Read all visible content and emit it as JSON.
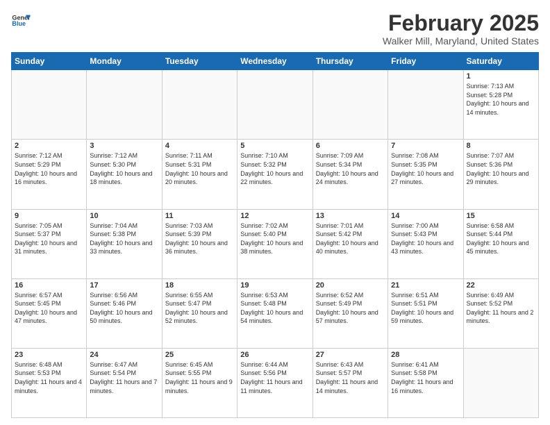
{
  "header": {
    "logo_line1": "General",
    "logo_line2": "Blue",
    "title": "February 2025",
    "subtitle": "Walker Mill, Maryland, United States"
  },
  "days_of_week": [
    "Sunday",
    "Monday",
    "Tuesday",
    "Wednesday",
    "Thursday",
    "Friday",
    "Saturday"
  ],
  "weeks": [
    [
      {
        "day": "",
        "info": ""
      },
      {
        "day": "",
        "info": ""
      },
      {
        "day": "",
        "info": ""
      },
      {
        "day": "",
        "info": ""
      },
      {
        "day": "",
        "info": ""
      },
      {
        "day": "",
        "info": ""
      },
      {
        "day": "1",
        "info": "Sunrise: 7:13 AM\nSunset: 5:28 PM\nDaylight: 10 hours and 14 minutes."
      }
    ],
    [
      {
        "day": "2",
        "info": "Sunrise: 7:12 AM\nSunset: 5:29 PM\nDaylight: 10 hours and 16 minutes."
      },
      {
        "day": "3",
        "info": "Sunrise: 7:12 AM\nSunset: 5:30 PM\nDaylight: 10 hours and 18 minutes."
      },
      {
        "day": "4",
        "info": "Sunrise: 7:11 AM\nSunset: 5:31 PM\nDaylight: 10 hours and 20 minutes."
      },
      {
        "day": "5",
        "info": "Sunrise: 7:10 AM\nSunset: 5:32 PM\nDaylight: 10 hours and 22 minutes."
      },
      {
        "day": "6",
        "info": "Sunrise: 7:09 AM\nSunset: 5:34 PM\nDaylight: 10 hours and 24 minutes."
      },
      {
        "day": "7",
        "info": "Sunrise: 7:08 AM\nSunset: 5:35 PM\nDaylight: 10 hours and 27 minutes."
      },
      {
        "day": "8",
        "info": "Sunrise: 7:07 AM\nSunset: 5:36 PM\nDaylight: 10 hours and 29 minutes."
      }
    ],
    [
      {
        "day": "9",
        "info": "Sunrise: 7:05 AM\nSunset: 5:37 PM\nDaylight: 10 hours and 31 minutes."
      },
      {
        "day": "10",
        "info": "Sunrise: 7:04 AM\nSunset: 5:38 PM\nDaylight: 10 hours and 33 minutes."
      },
      {
        "day": "11",
        "info": "Sunrise: 7:03 AM\nSunset: 5:39 PM\nDaylight: 10 hours and 36 minutes."
      },
      {
        "day": "12",
        "info": "Sunrise: 7:02 AM\nSunset: 5:40 PM\nDaylight: 10 hours and 38 minutes."
      },
      {
        "day": "13",
        "info": "Sunrise: 7:01 AM\nSunset: 5:42 PM\nDaylight: 10 hours and 40 minutes."
      },
      {
        "day": "14",
        "info": "Sunrise: 7:00 AM\nSunset: 5:43 PM\nDaylight: 10 hours and 43 minutes."
      },
      {
        "day": "15",
        "info": "Sunrise: 6:58 AM\nSunset: 5:44 PM\nDaylight: 10 hours and 45 minutes."
      }
    ],
    [
      {
        "day": "16",
        "info": "Sunrise: 6:57 AM\nSunset: 5:45 PM\nDaylight: 10 hours and 47 minutes."
      },
      {
        "day": "17",
        "info": "Sunrise: 6:56 AM\nSunset: 5:46 PM\nDaylight: 10 hours and 50 minutes."
      },
      {
        "day": "18",
        "info": "Sunrise: 6:55 AM\nSunset: 5:47 PM\nDaylight: 10 hours and 52 minutes."
      },
      {
        "day": "19",
        "info": "Sunrise: 6:53 AM\nSunset: 5:48 PM\nDaylight: 10 hours and 54 minutes."
      },
      {
        "day": "20",
        "info": "Sunrise: 6:52 AM\nSunset: 5:49 PM\nDaylight: 10 hours and 57 minutes."
      },
      {
        "day": "21",
        "info": "Sunrise: 6:51 AM\nSunset: 5:51 PM\nDaylight: 10 hours and 59 minutes."
      },
      {
        "day": "22",
        "info": "Sunrise: 6:49 AM\nSunset: 5:52 PM\nDaylight: 11 hours and 2 minutes."
      }
    ],
    [
      {
        "day": "23",
        "info": "Sunrise: 6:48 AM\nSunset: 5:53 PM\nDaylight: 11 hours and 4 minutes."
      },
      {
        "day": "24",
        "info": "Sunrise: 6:47 AM\nSunset: 5:54 PM\nDaylight: 11 hours and 7 minutes."
      },
      {
        "day": "25",
        "info": "Sunrise: 6:45 AM\nSunset: 5:55 PM\nDaylight: 11 hours and 9 minutes."
      },
      {
        "day": "26",
        "info": "Sunrise: 6:44 AM\nSunset: 5:56 PM\nDaylight: 11 hours and 11 minutes."
      },
      {
        "day": "27",
        "info": "Sunrise: 6:43 AM\nSunset: 5:57 PM\nDaylight: 11 hours and 14 minutes."
      },
      {
        "day": "28",
        "info": "Sunrise: 6:41 AM\nSunset: 5:58 PM\nDaylight: 11 hours and 16 minutes."
      },
      {
        "day": "",
        "info": ""
      }
    ]
  ]
}
